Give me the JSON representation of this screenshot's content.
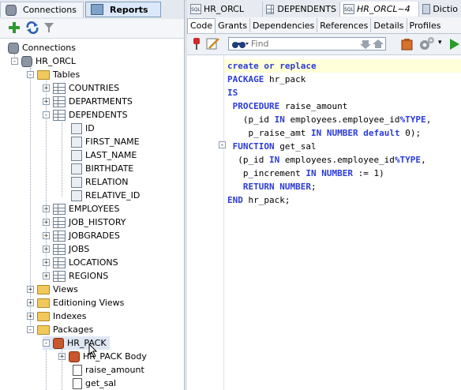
{
  "left_panel": {
    "tabs": [
      {
        "label": "Connections"
      },
      {
        "label": "Reports"
      }
    ],
    "toolbar": {
      "add_icon": "plus-icon",
      "refresh_icon": "refresh-icon",
      "filter_icon": "filter-icon"
    },
    "tree": {
      "root": "Connections",
      "connection": "HR_ORCL",
      "tables_folder": "Tables",
      "tables": [
        "COUNTRIES",
        "DEPARTMENTS",
        "DEPENDENTS"
      ],
      "dependents_columns": [
        "ID",
        "FIRST_NAME",
        "LAST_NAME",
        "BIRTHDATE",
        "RELATION",
        "RELATIVE_ID"
      ],
      "tables_after": [
        "EMPLOYEES",
        "JOB_HISTORY",
        "JOBGRADES",
        "JOBS",
        "LOCATIONS",
        "REGIONS"
      ],
      "views": "Views",
      "editioning_views": "Editioning Views",
      "indexes": "Indexes",
      "packages": "Packages",
      "package": "HR_PACK",
      "package_body": "HR_PACK Body",
      "procedures": [
        "raise_amount",
        "get_sal"
      ]
    }
  },
  "editor": {
    "doc_tabs": [
      {
        "label": "HR_ORCL"
      },
      {
        "label": "DEPENDENTS"
      },
      {
        "label": "HR_ORCL~4"
      },
      {
        "label": "Dictio"
      }
    ],
    "sub_tabs": [
      "Code",
      "Grants",
      "Dependencies",
      "References",
      "Details",
      "Profiles"
    ],
    "find_placeholder": "Find",
    "code_lines": [
      "create or replace",
      "PACKAGE hr_pack",
      "IS",
      " PROCEDURE raise_amount",
      "   (p_id IN employees.employee_id%TYPE,",
      "    p_raise_amt IN NUMBER default 0);",
      " FUNCTION get_sal",
      "  (p_id IN employees.employee_id%TYPE,",
      "   p_increment IN NUMBER := 1)",
      "   RETURN NUMBER;",
      "END hr_pack;"
    ]
  },
  "colors": {
    "keyword": "#2b3bd8",
    "current_line": "#ffffd9",
    "tree_selection": "#dfe7f3"
  }
}
